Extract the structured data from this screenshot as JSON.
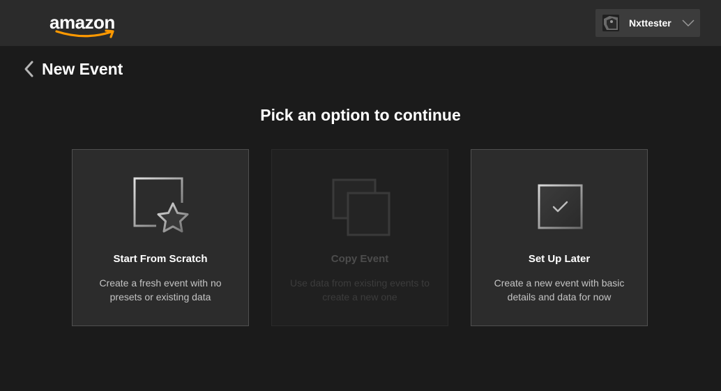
{
  "header": {
    "logo_text": "amazon",
    "user": {
      "name": "Nxttester"
    }
  },
  "page": {
    "title": "New Event",
    "prompt": "Pick an option to continue"
  },
  "options": [
    {
      "title": "Start From Scratch",
      "description": "Create a fresh event with no presets or existing data",
      "icon": "star-frame-icon",
      "enabled": true
    },
    {
      "title": "Copy Event",
      "description": "Use data from existing events to create a new one",
      "icon": "copy-frames-icon",
      "enabled": false
    },
    {
      "title": "Set Up Later",
      "description": "Create a new event with basic details and data for now",
      "icon": "check-frame-icon",
      "enabled": true
    }
  ],
  "colors": {
    "background": "#1b1b1b",
    "header": "#2b2b2b",
    "card": "#2c2c2c",
    "logo_smile": "#ff9900"
  }
}
